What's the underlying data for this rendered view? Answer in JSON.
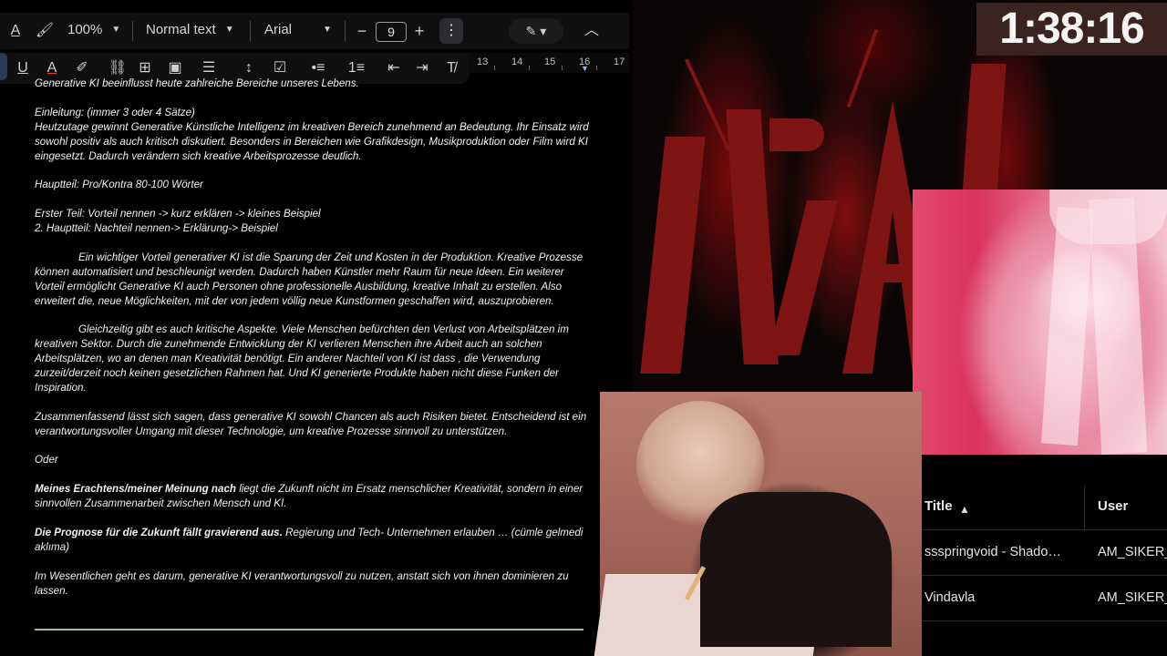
{
  "toolbar": {
    "zoom": "100%",
    "style": "Normal text",
    "font": "Arial",
    "font_size": "9",
    "minus": "−",
    "plus": "+"
  },
  "ruler": {
    "marks": [
      "13",
      "14",
      "15",
      "16",
      "17"
    ]
  },
  "timer": "1:38:16",
  "document": {
    "title": "Generative KI beeinflusst heute zahlreiche Bereiche unseres Lebens.",
    "intro_label": "Einleitung: (immer 3 oder 4 Sätze)",
    "intro_text": "Heutzutage gewinnt Generative Künstliche Intelligenz im kreativen Bereich zunehmend an Bedeutung. Ihr Einsatz wird sowohl positiv als auch kritisch diskutiert. Besonders in Bereichen wie Grafikdesign, Musikproduktion oder Film wird KI eingesetzt. Dadurch verändern sich kreative Arbeitsprozesse deutlich.",
    "main_label": "Hauptteil: Pro/Kontra 80-100 Wörter",
    "first_part": "Erster Teil: Vorteil nennen -> kurz erklären -> kleines Beispiel",
    "second_part": "2. Hauptteil: Nachteil nennen-> Erklärung-> Beispiel",
    "para_pro": "Ein wichtiger Vorteil generativer KI ist die Sparung der Zeit und Kosten in der Produktion. Kreative Prozesse können automatisiert und beschleunigt werden. Dadurch haben Künstler mehr Raum für neue Ideen. Ein weiterer Vorteil ermöglicht Generative KI auch Personen ohne professionelle Ausbildung, kreative Inhalt zu erstellen. Also erweitert die, neue Möglichkeiten, mit der von jedem völlig neue Kunstformen geschaffen wird, auszuprobieren.",
    "para_contra": "Gleichzeitig gibt es auch kritische Aspekte. Viele Menschen befürchten den Verlust von Arbeitsplätzen im kreativen Sektor. Durch die zunehmende Entwicklung der KI verlieren Menschen ihre Arbeit auch an solchen Arbeitsplätzen, wo an denen man Kreativität benötigt. Ein anderer Nachteil von KI ist dass , die Verwendung zurzeit/derzeit noch keinen gesetzlichen Rahmen hat. Und KI generierte Produkte haben nicht diese Funken der Inspiration.",
    "conclusion": "Zusammenfassend lässt sich sagen, dass generative KI sowohl Chancen als auch Risiken bietet. Entscheidend ist ein verantwortungsvoller Umgang mit dieser Technologie, um kreative Prozesse sinnvoll zu unterstützen.",
    "oder": "Oder",
    "opinion_bold": "Meines Erachtens/meiner Meinung nach",
    "opinion_rest": " liegt die Zukunft nicht im Ersatz menschlicher Kreativität, sondern in einer sinnvollen Zusammenarbeit zwischen Mensch und KI.",
    "prognose_bold": "Die Prognose für die Zukunft fällt gravierend aus.",
    "prognose_rest": " Regierung und Tech- Unternehmen erlauben … (cümle gelmedi aklıma)",
    "final": "Im Wesentlichen geht es darum, generative KI verantwortungsvoll zu nutzen, anstatt sich von ihnen dominieren zu lassen."
  },
  "table": {
    "headers": [
      "Title",
      "User"
    ],
    "rows": [
      [
        "ssspringvoid - Shado…",
        "AM_SIKER_"
      ],
      [
        "Vindavla",
        "AM_SIKER_"
      ]
    ]
  }
}
